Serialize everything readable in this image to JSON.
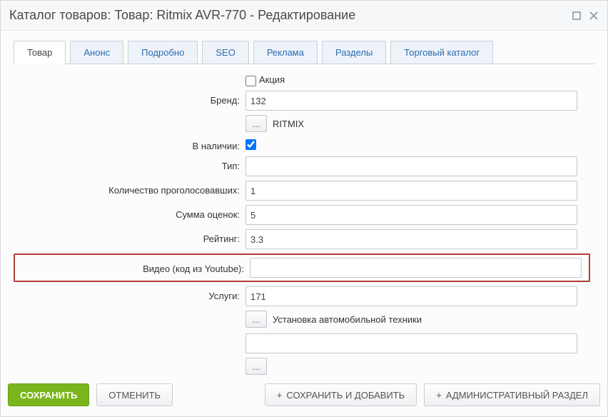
{
  "window": {
    "title": "Каталог товаров: Товар: Ritmix AVR-770 - Редактирование"
  },
  "tabs": [
    {
      "label": "Товар",
      "active": true
    },
    {
      "label": "Анонс",
      "active": false
    },
    {
      "label": "Подробно",
      "active": false
    },
    {
      "label": "SEO",
      "active": false
    },
    {
      "label": "Реклама",
      "active": false
    },
    {
      "label": "Разделы",
      "active": false
    },
    {
      "label": "Торговый каталог",
      "active": false
    }
  ],
  "form": {
    "action_label": "Акция",
    "action_checked": false,
    "brand_label": "Бренд:",
    "brand_value": "132",
    "brand_pick_btn": "...",
    "brand_resolved": "RITMIX",
    "instock_label": "В наличии:",
    "instock_checked": true,
    "type_label": "Тип:",
    "type_value": "",
    "votes_label": "Количество проголосовавших:",
    "votes_value": "1",
    "sum_label": "Сумма оценок:",
    "sum_value": "5",
    "rating_label": "Рейтинг:",
    "rating_value": "3.3",
    "video_label": "Видео (код из Youtube):",
    "video_value": "",
    "services_label": "Услуги:",
    "services_value": "171",
    "services_pick_btn": "...",
    "services_resolved": "Установка автомобильной техники",
    "services_value2": "",
    "services_pick_btn2": "..."
  },
  "footer": {
    "save": "СОХРАНИТЬ",
    "cancel": "ОТМЕНИТЬ",
    "save_add": "СОХРАНИТЬ И ДОБАВИТЬ",
    "admin": "АДМИНИСТРАТИВНЫЙ РАЗДЕЛ"
  }
}
